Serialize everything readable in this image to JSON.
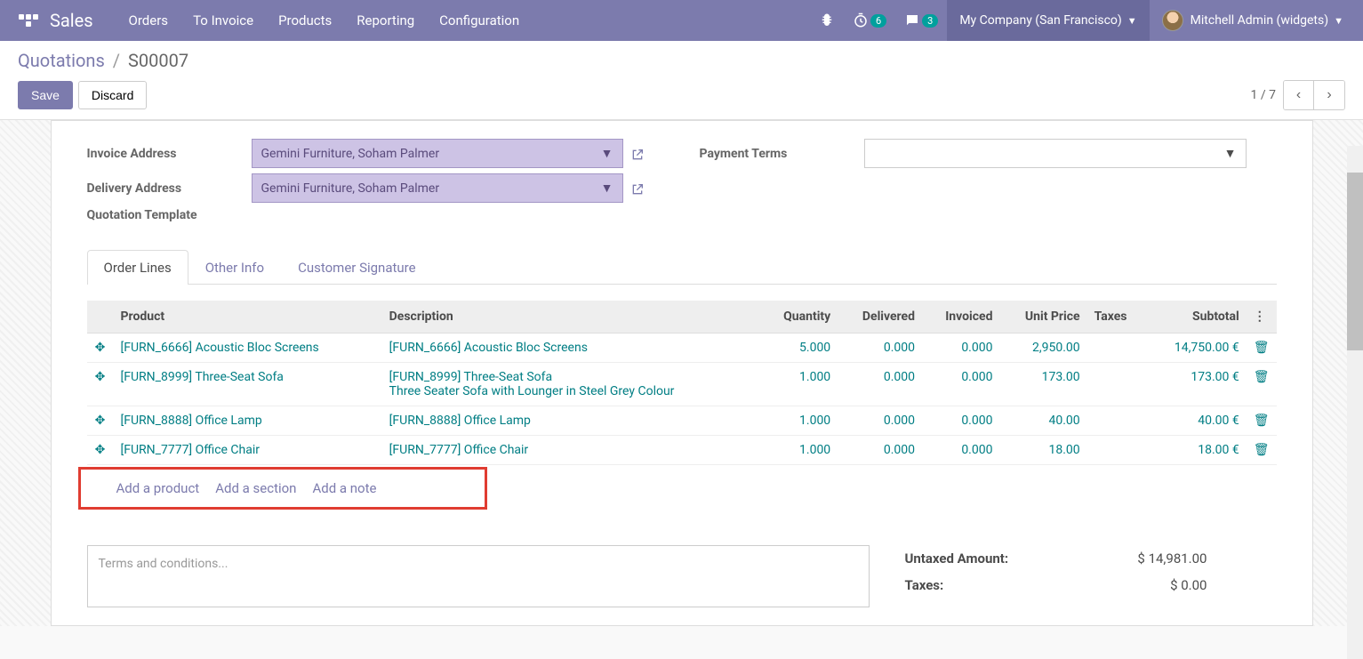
{
  "nav": {
    "brand": "Sales",
    "menu": [
      "Orders",
      "To Invoice",
      "Products",
      "Reporting",
      "Configuration"
    ],
    "badge_timer": "6",
    "badge_chat": "3",
    "company": "My Company (San Francisco)",
    "user": "Mitchell Admin (widgets)"
  },
  "breadcrumb": {
    "root": "Quotations",
    "current": "S00007"
  },
  "buttons": {
    "save": "Save",
    "discard": "Discard"
  },
  "pager": {
    "text": "1 / 7"
  },
  "form": {
    "invoice_label": "Invoice Address",
    "invoice_value": "Gemini Furniture, Soham Palmer",
    "delivery_label": "Delivery Address",
    "delivery_value": "Gemini Furniture, Soham Palmer",
    "template_label": "Quotation Template",
    "payment_label": "Payment Terms"
  },
  "tabs": [
    "Order Lines",
    "Other Info",
    "Customer Signature"
  ],
  "cols": {
    "product": "Product",
    "desc": "Description",
    "qty": "Quantity",
    "deliv": "Delivered",
    "inv": "Invoiced",
    "price": "Unit Price",
    "tax": "Taxes",
    "sub": "Subtotal"
  },
  "lines": [
    {
      "product": "[FURN_6666] Acoustic Bloc Screens",
      "desc": "[FURN_6666] Acoustic Bloc Screens",
      "qty": "5.000",
      "deliv": "0.000",
      "inv": "0.000",
      "price": "2,950.00",
      "sub": "14,750.00 €"
    },
    {
      "product": "[FURN_8999] Three-Seat Sofa",
      "desc": "[FURN_8999] Three-Seat Sofa\nThree Seater Sofa with Lounger in Steel Grey Colour",
      "qty": "1.000",
      "deliv": "0.000",
      "inv": "0.000",
      "price": "173.00",
      "sub": "173.00 €"
    },
    {
      "product": "[FURN_8888] Office Lamp",
      "desc": "[FURN_8888] Office Lamp",
      "qty": "1.000",
      "deliv": "0.000",
      "inv": "0.000",
      "price": "40.00",
      "sub": "40.00 €"
    },
    {
      "product": "[FURN_7777] Office Chair",
      "desc": "[FURN_7777] Office Chair",
      "qty": "1.000",
      "deliv": "0.000",
      "inv": "0.000",
      "price": "18.00",
      "sub": "18.00 €"
    }
  ],
  "add": {
    "product": "Add a product",
    "section": "Add a section",
    "note": "Add a note"
  },
  "terms_placeholder": "Terms and conditions...",
  "totals": {
    "untaxed_label": "Untaxed Amount:",
    "untaxed_val": "$ 14,981.00",
    "tax_label": "Taxes:",
    "tax_val": "$ 0.00"
  }
}
